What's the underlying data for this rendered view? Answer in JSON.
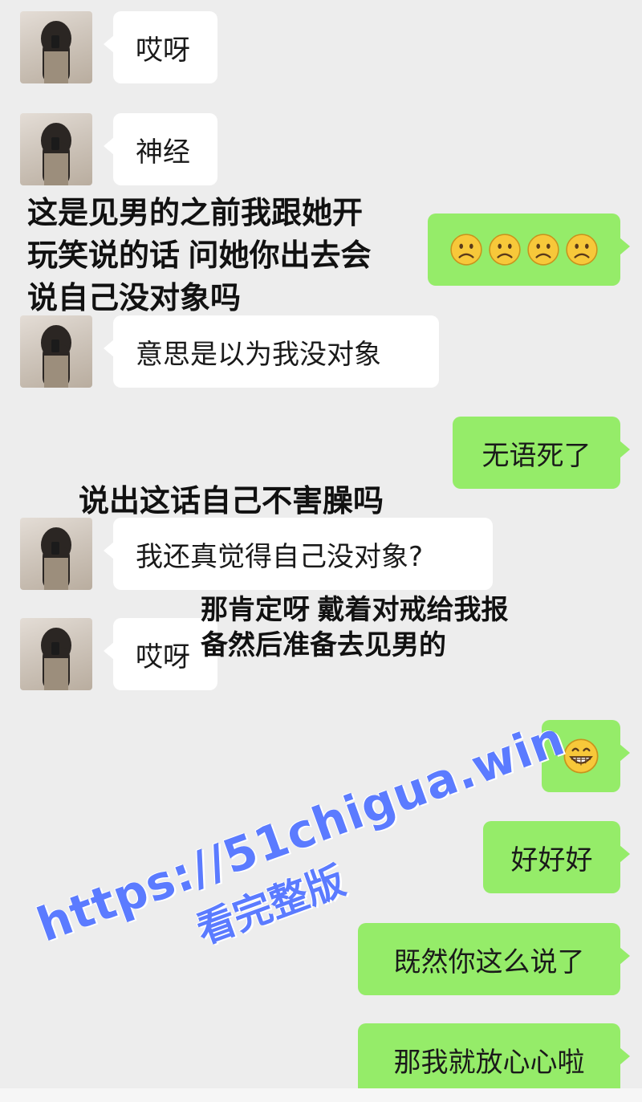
{
  "messages": [
    {
      "side": "in",
      "text": "哎呀"
    },
    {
      "side": "in",
      "text": "神经"
    },
    {
      "side": "out",
      "emoji": [
        "frowning-face",
        "frowning-face",
        "frowning-face",
        "frowning-face"
      ]
    },
    {
      "side": "in",
      "text": "意思是以为我没对象"
    },
    {
      "side": "out",
      "text": "无语死了"
    },
    {
      "side": "in",
      "text": "我还真觉得自己没对象?"
    },
    {
      "side": "in",
      "text": "哎呀"
    },
    {
      "side": "out",
      "emoji": [
        "grinning-face"
      ]
    },
    {
      "side": "out",
      "text": "好好好"
    },
    {
      "side": "out",
      "text": "既然你这么说了"
    },
    {
      "side": "out",
      "text": "那我就放心心啦"
    }
  ],
  "annotations": [
    {
      "lines": [
        "这是见男的之前我跟她开",
        "玩笑说的话 问她你出去会",
        "说自己没对象吗"
      ]
    },
    {
      "lines": [
        "说出这话自己不害臊吗"
      ]
    },
    {
      "lines": [
        "那肯定呀 戴着对戒给我报",
        "备然后准备去见男的"
      ]
    }
  ],
  "watermark": {
    "url": "https://51chigua.win",
    "subtitle": "看完整版"
  },
  "colors": {
    "background": "#ededed",
    "incoming_bubble": "#ffffff",
    "outgoing_bubble": "#95ec69",
    "watermark": "#5b7bff"
  }
}
